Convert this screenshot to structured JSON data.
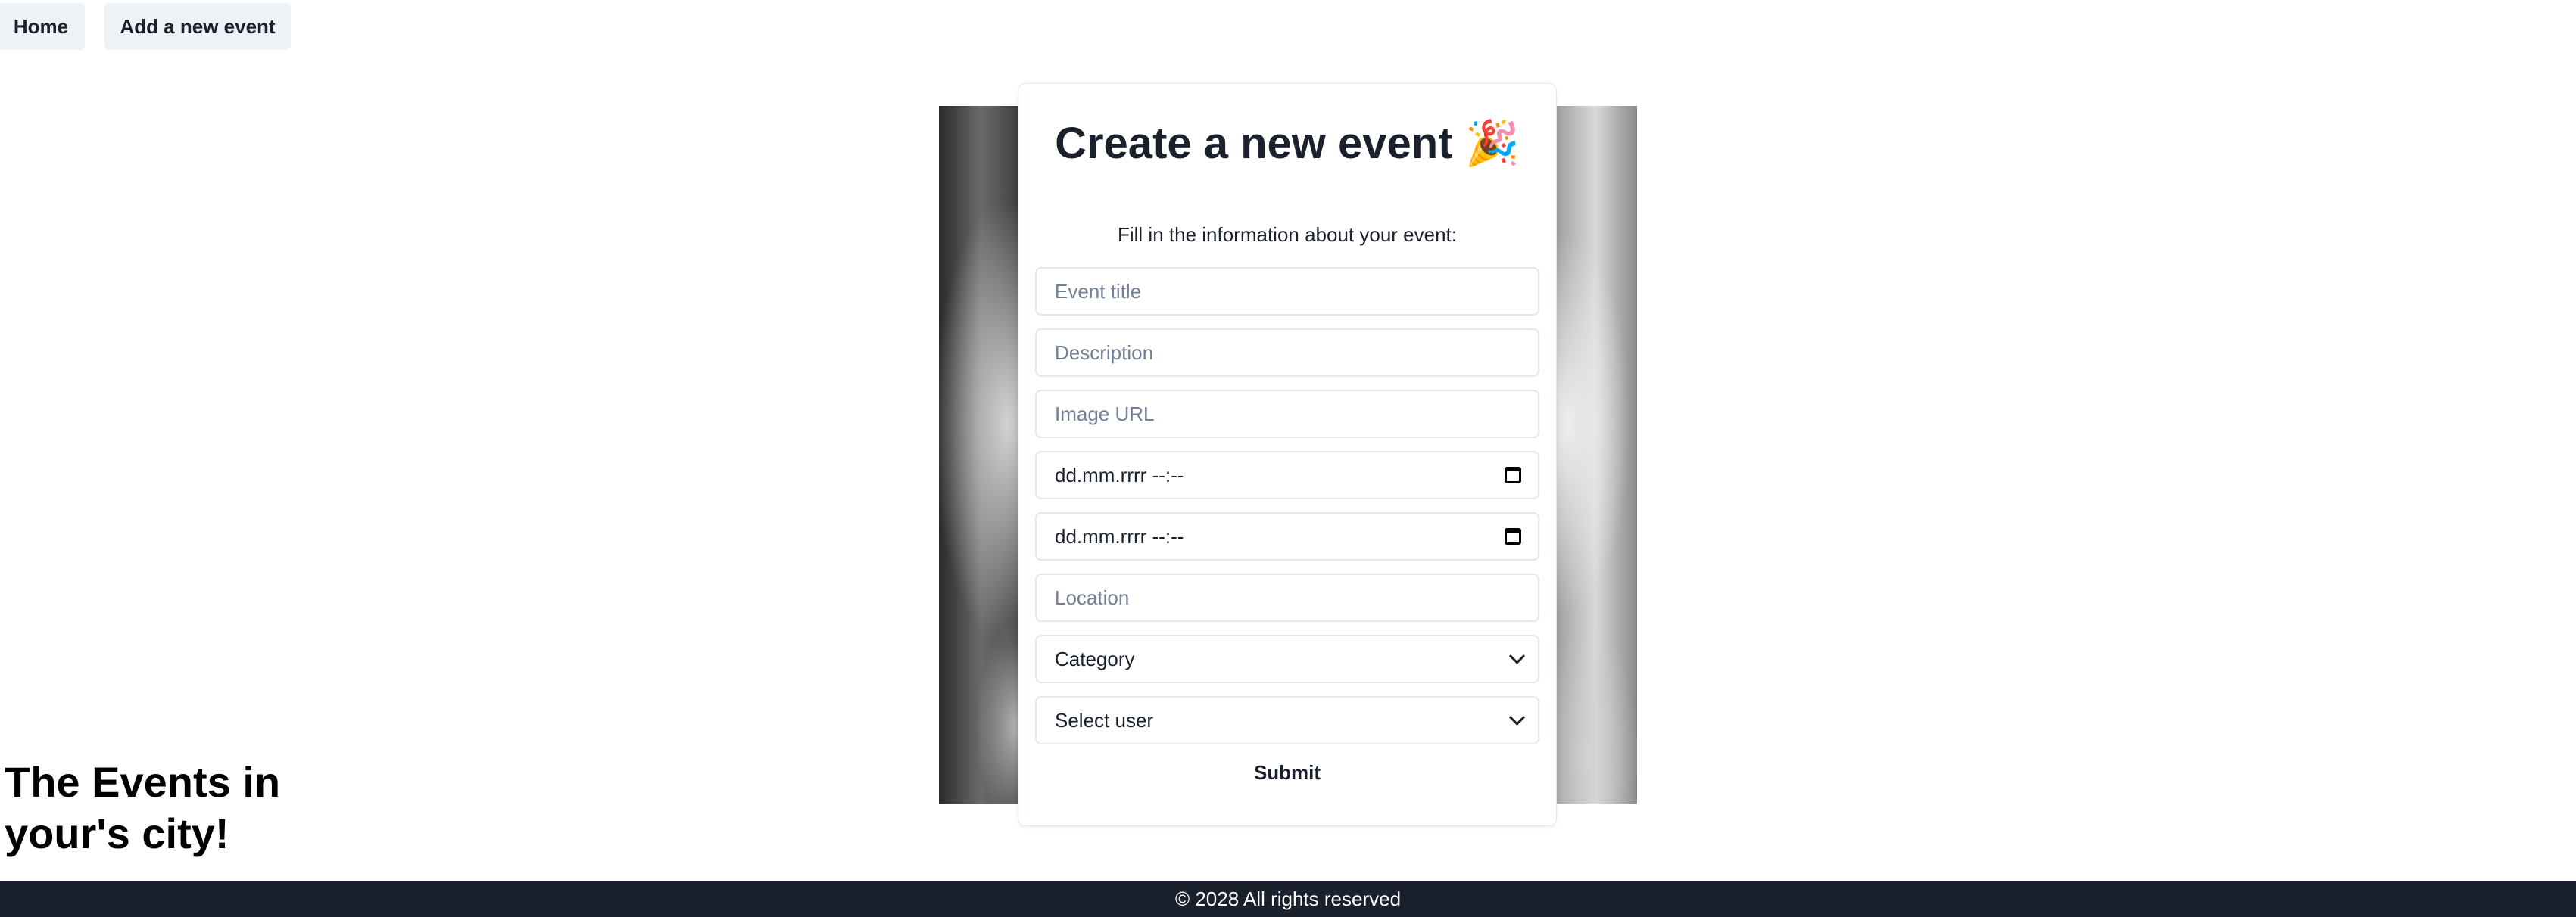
{
  "nav": {
    "home_label": "Home",
    "add_event_label": "Add a new event"
  },
  "form": {
    "title": "Create a new event 🎉",
    "subtitle": "Fill in the information about your event:",
    "fields": {
      "title_placeholder": "Event title",
      "description_placeholder": "Description",
      "image_placeholder": "Image URL",
      "start_datetime_value": "dd.mm.rrrr --:--",
      "end_datetime_value": "dd.mm.rrrr --:--",
      "location_placeholder": "Location",
      "category_selected": "Category",
      "user_selected": "Select user"
    },
    "submit_label": "Submit"
  },
  "tagline": "The Events in your's city!",
  "footer": {
    "text": "© 2028 All rights reserved"
  },
  "colors": {
    "nav_button_bg": "#edf2f7",
    "footer_bg": "#1a202c",
    "text_dark": "#1a202c",
    "placeholder": "#718096",
    "border": "#e2e8f0"
  }
}
